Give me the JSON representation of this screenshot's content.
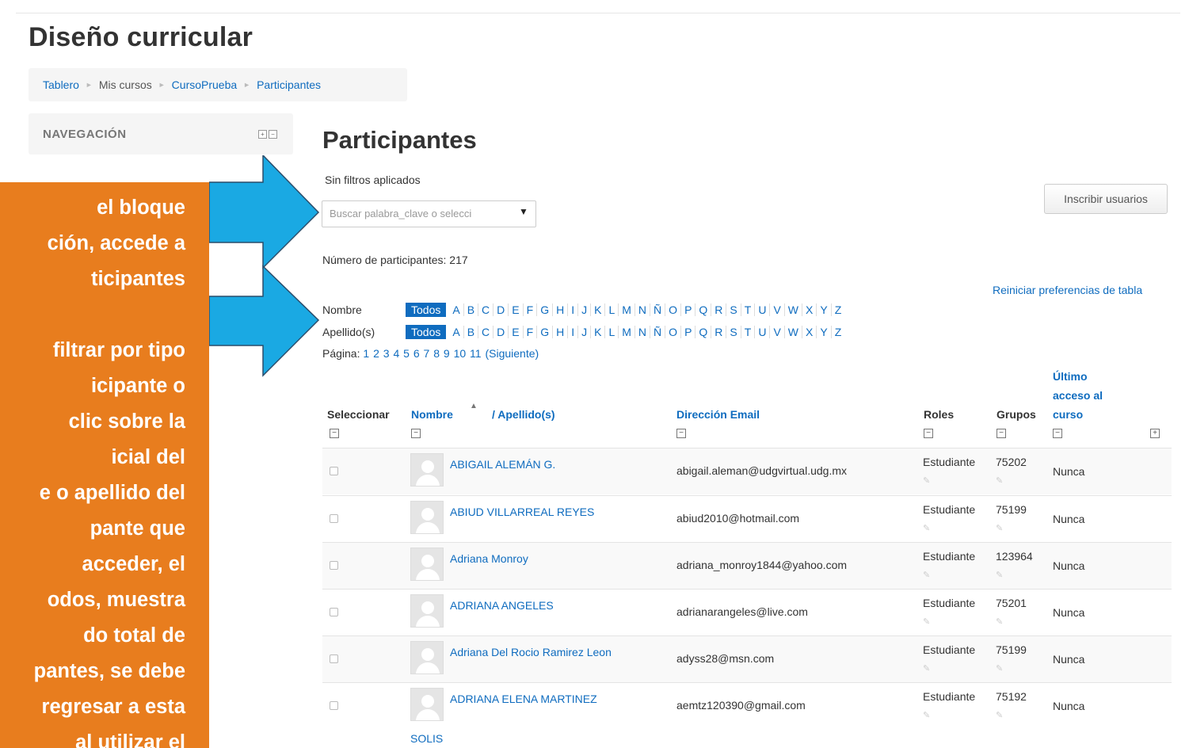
{
  "site": {
    "title": "Diseño curricular"
  },
  "breadcrumb": [
    "Tablero",
    "Mis cursos",
    "CursoPrueba",
    "Participantes"
  ],
  "nav_block": {
    "title": "NAVEGACIÓN"
  },
  "callout": {
    "lines": [
      "el bloque",
      "ción, accede a",
      "ticipantes",
      "",
      "filtrar por tipo",
      "icipante o",
      "clic sobre la",
      "icial del",
      "e o apellido del",
      "pante que",
      "acceder, el",
      "odos, muestra",
      "do total de",
      "pantes, se debe",
      "regresar a esta",
      "al utilizar el"
    ]
  },
  "page": {
    "heading": "Participantes",
    "no_filters": "Sin filtros aplicados",
    "filter_placeholder": "Buscar palabra_clave o selecci",
    "enroll_button": "Inscribir usuarios",
    "count": "Número de participantes: 217",
    "reset_link": "Reiniciar preferencias de tabla"
  },
  "alpha_filter": {
    "rows": [
      {
        "label": "Nombre",
        "all": "Todos"
      },
      {
        "label": "Apellido(s)",
        "all": "Todos"
      }
    ],
    "letters": [
      "A",
      "B",
      "C",
      "D",
      "E",
      "F",
      "G",
      "H",
      "I",
      "J",
      "K",
      "L",
      "M",
      "N",
      "Ñ",
      "O",
      "P",
      "Q",
      "R",
      "S",
      "T",
      "U",
      "V",
      "W",
      "X",
      "Y",
      "Z"
    ]
  },
  "pager": {
    "label": "Página:",
    "pages": [
      "1",
      "2",
      "3",
      "4",
      "5",
      "6",
      "7",
      "8",
      "9",
      "10",
      "11"
    ],
    "next": "(Siguiente)"
  },
  "table": {
    "headers": {
      "select": "Seleccionar",
      "first_name": "Nombre",
      "last_name": "/ Apellido(s)",
      "email": "Dirección Email",
      "roles": "Roles",
      "groups": "Grupos",
      "last_access": [
        "Último",
        "acceso al",
        "curso"
      ]
    },
    "rows": [
      {
        "name": "ABIGAIL ALEMÁN G.",
        "name2": "",
        "email": "abigail.aleman@udgvirtual.udg.mx",
        "role": "Estudiante",
        "group": "75202",
        "access": "Nunca"
      },
      {
        "name": "ABIUD VILLARREAL REYES",
        "name2": "",
        "email": "abiud2010@hotmail.com",
        "role": "Estudiante",
        "group": "75199",
        "access": "Nunca"
      },
      {
        "name": "Adriana Monroy",
        "name2": "",
        "email": "adriana_monroy1844@yahoo.com",
        "role": "Estudiante",
        "group": "123964",
        "access": "Nunca"
      },
      {
        "name": "ADRIANA ANGELES",
        "name2": "",
        "email": "adrianarangeles@live.com",
        "role": "Estudiante",
        "group": "75201",
        "access": "Nunca"
      },
      {
        "name": "Adriana Del Rocio Ramirez Leon",
        "name2": "",
        "email": "adyss28@msn.com",
        "role": "Estudiante",
        "group": "75199",
        "access": "Nunca"
      },
      {
        "name": "ADRIANA ELENA MARTINEZ",
        "name2": "SOLIS",
        "email": "aemtz120390@gmail.com",
        "role": "Estudiante",
        "group": "75192",
        "access": "Nunca"
      }
    ]
  },
  "colors": {
    "link": "#0f6cbf",
    "callout": "#e87d1e",
    "arrow": "#1aa9e3"
  }
}
